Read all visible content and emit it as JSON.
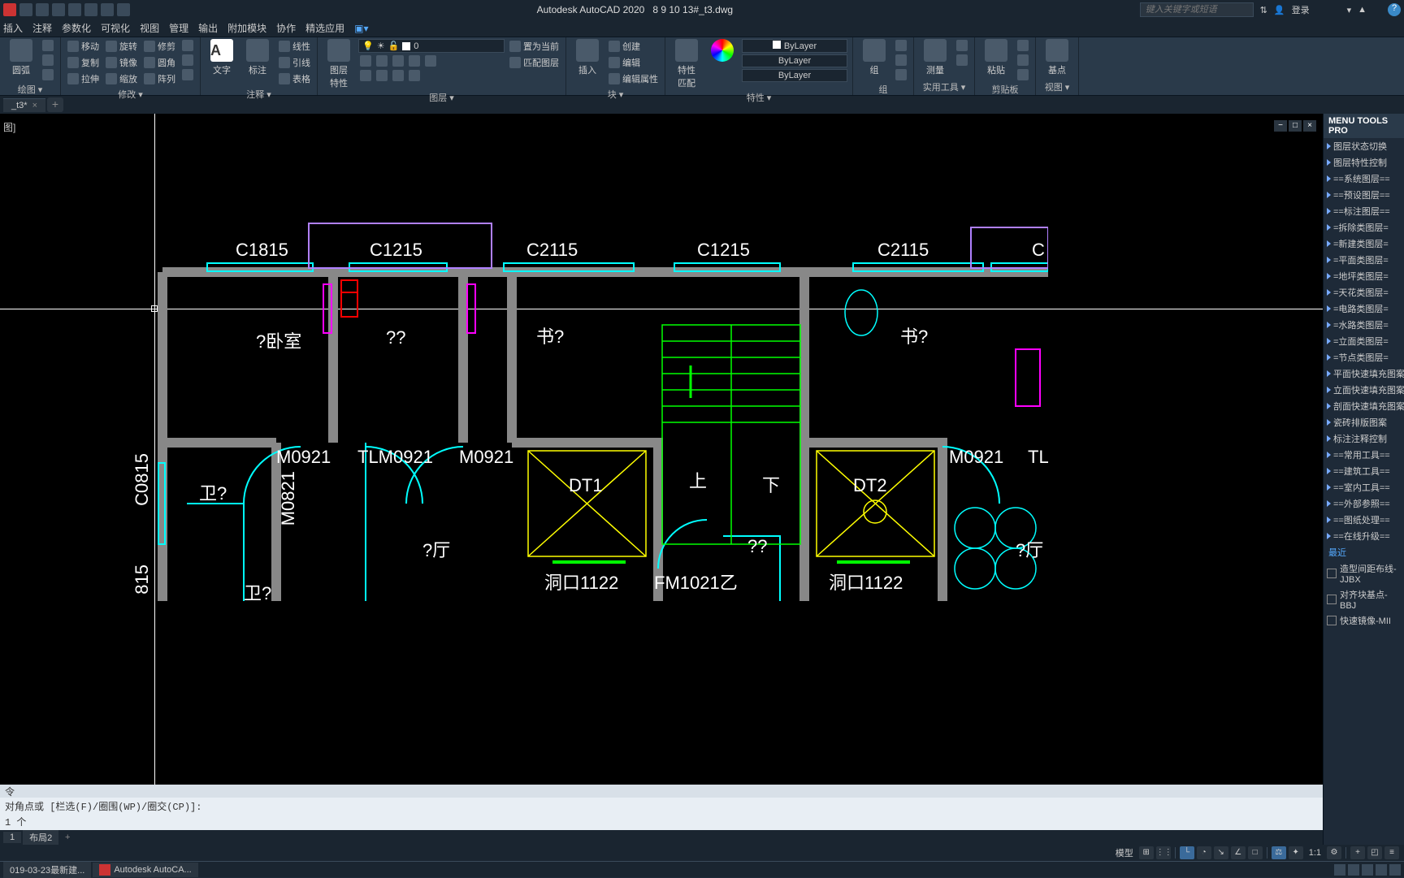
{
  "title": {
    "app": "Autodesk AutoCAD 2020",
    "file": "8 9 10 13#_t3.dwg"
  },
  "search_placeholder": "键入关键字或短语",
  "login": "登录",
  "menus": [
    "插入",
    "注释",
    "参数化",
    "可视化",
    "视图",
    "管理",
    "输出",
    "附加模块",
    "协作",
    "精选应用"
  ],
  "ribbon": {
    "draw": {
      "label": "绘图 ▾",
      "arc": "圆弧"
    },
    "modify": {
      "label": "修改 ▾",
      "move": "移动",
      "rotate": "旋转",
      "trim": "修剪",
      "copy": "复制",
      "mirror": "镜像",
      "fillet": "圆角",
      "stretch": "拉伸",
      "scale": "缩放",
      "array": "阵列"
    },
    "annot": {
      "label": "注释 ▾",
      "text": "文字",
      "dim": "标注",
      "linear": "线性",
      "leader": "引线",
      "table": "表格"
    },
    "layers": {
      "label": "图层 ▾",
      "prop": "图层\n特性",
      "current": "0",
      "set": "置为当前",
      "match": "匹配图层"
    },
    "block": {
      "label": "块 ▾",
      "insert": "插入",
      "create": "创建",
      "edit": "编辑",
      "editattr": "编辑属性"
    },
    "prop": {
      "label": "特性 ▾",
      "match": "特性\n匹配",
      "bylayer": "ByLayer"
    },
    "group": {
      "label": "组",
      "g": "组"
    },
    "util": {
      "label": "实用工具 ▾",
      "measure": "测量"
    },
    "clip": {
      "label": "剪贴板",
      "paste": "粘贴"
    },
    "view": {
      "label": "视图 ▾",
      "base": "基点"
    }
  },
  "doctab": "_t3*",
  "side": {
    "title": "MENU TOOLS PRO",
    "items": [
      "图层状态切换",
      "图层特性控制",
      "==系统图层==",
      "==预设图层==",
      "==标注图层==",
      "=拆除类图层=",
      "=新建类图层=",
      "=平面类图层=",
      "=地坪类图层=",
      "=天花类图层=",
      "=电路类图层=",
      "=水路类图层=",
      "=立面类图层=",
      "=节点类图层=",
      "平面快速填充图案",
      "立面快速填充图案",
      "剖面快速填充图案",
      "瓷砖排版图案",
      "标注注释控制",
      "==常用工具==",
      "==建筑工具==",
      "==室内工具==",
      "==外部参照==",
      "==图纸处理==",
      "==在线升级=="
    ],
    "recent_label": "最近",
    "recent": [
      "造型间距布线-JJBX",
      "对齐块基点-BBJ",
      "快速镜像-MII"
    ]
  },
  "cmd": {
    "line1": "对角点或 [栏选(F)/圈围(WP)/圈交(CP)]:",
    "line2": "1 个",
    "line3": "令"
  },
  "layouts": {
    "l1": "1",
    "l2": "布局2"
  },
  "status": {
    "model": "模型",
    "scale": "1:1"
  },
  "taskbar": {
    "b1": "019-03-23最新建...",
    "b2": "Autodesk AutoCA..."
  },
  "dwg_labels": {
    "c1815": "C1815",
    "c1215a": "C1215",
    "c2115a": "C2115",
    "c1215b": "C1215",
    "c2115b": "C2115",
    "bedroom": "?卧室",
    "q1": "??",
    "shu1": "书?",
    "shu2": "书?",
    "c0815": "C0815",
    "m0921a": "M0921",
    "tlm0921": "TLM0921",
    "m0921b": "M0921",
    "m0921c": "M0921",
    "tl": "TL",
    "m0821": "M0821",
    "w1": "卫?",
    "w2": "卫?",
    "t1": "?厅",
    "q2": "??",
    "t2": "?厅",
    "dt1": "DT1",
    "dt2": "DT2",
    "up": "上",
    "down": "下",
    "dk1": "洞口1122",
    "fm": "FM1021乙",
    "dk2": "洞口1122",
    "b815": "815"
  }
}
